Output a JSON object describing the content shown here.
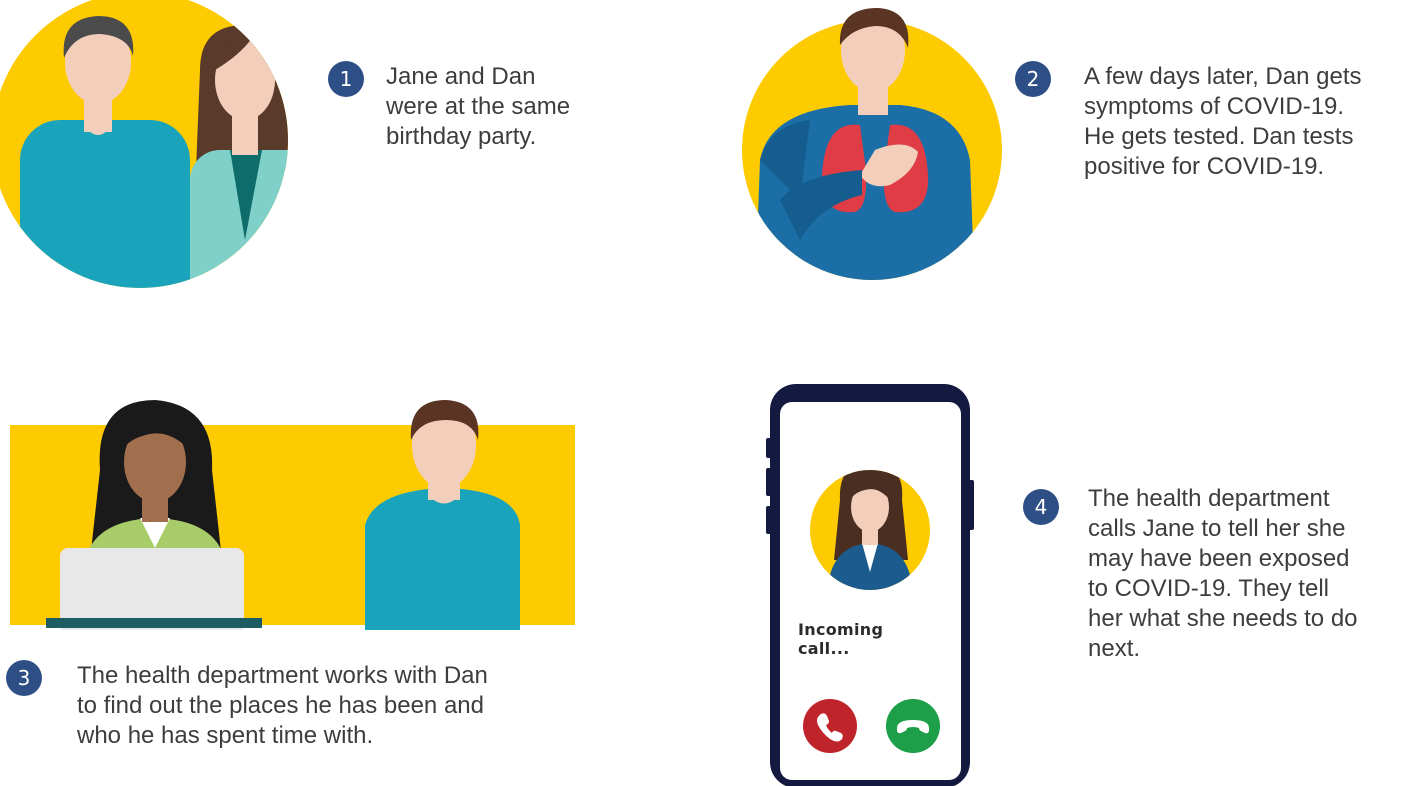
{
  "colors": {
    "yellow": "#fecb00",
    "badge": "#2e4f85",
    "teal_shirt": "#1aa4bb",
    "navy_phone": "#141a3f",
    "decline": "#c0242b",
    "accept": "#1d9f4a"
  },
  "steps": [
    {
      "number": "1",
      "lines": [
        "Jane and Dan",
        "were at the same",
        "birthday party."
      ],
      "illustration": "jane-and-dan-illustration"
    },
    {
      "number": "2",
      "lines": [
        "A few days later, Dan gets",
        "symptoms of COVID-19.",
        "He gets tested. Dan tests",
        "positive for COVID-19."
      ],
      "illustration": "dan-sick-illustration"
    },
    {
      "number": "3",
      "lines": [
        "The health department works with Dan",
        "to find out the places he has been and",
        "who he has spent time with."
      ],
      "illustration": "health-worker-with-dan-illustration"
    },
    {
      "number": "4",
      "lines": [
        "The health department",
        "calls Jane to tell her she",
        "may have been exposed",
        "to COVID-19. They tell",
        "her what she needs to do",
        "next."
      ],
      "illustration": "phone-call-illustration"
    }
  ],
  "phone": {
    "status": "Incoming call...",
    "decline_icon": "phone-decline-icon",
    "accept_icon": "phone-accept-icon"
  }
}
